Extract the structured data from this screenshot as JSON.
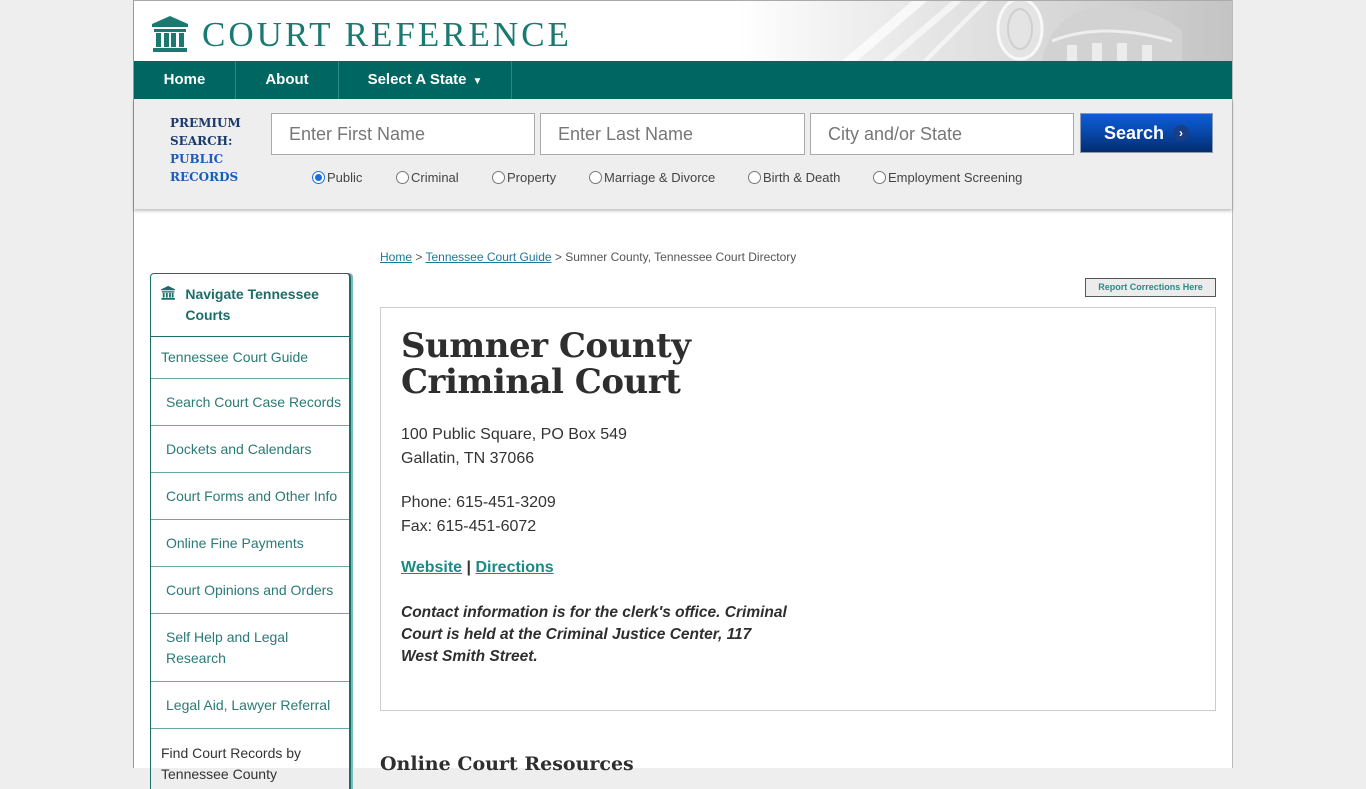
{
  "brand": {
    "name": "COURT REFERENCE",
    "color": "#1a7a72"
  },
  "nav": {
    "home": "Home",
    "about": "About",
    "select_state": "Select A State",
    "select_state_caret": "▼",
    "bg_color": "#006661"
  },
  "search": {
    "label_line1": "PREMIUM",
    "label_line2": "SEARCH:",
    "label_line3": "PUBLIC",
    "label_line4": "RECORDS",
    "first_name_placeholder": "Enter First Name",
    "last_name_placeholder": "Enter Last Name",
    "city_state_placeholder": "City and/or State",
    "button_label": "Search",
    "button_chevron": "›",
    "record_types": [
      {
        "label": "Public",
        "checked": true
      },
      {
        "label": "Criminal",
        "checked": false
      },
      {
        "label": "Property",
        "checked": false
      },
      {
        "label": "Marriage & Divorce",
        "checked": false
      },
      {
        "label": "Birth & Death",
        "checked": false
      },
      {
        "label": "Employment Screening",
        "checked": false
      }
    ]
  },
  "sidebar": {
    "title": "Navigate Tennessee Courts",
    "items": [
      {
        "label": "Tennessee Court Guide"
      },
      {
        "label": "Search Court Case Records"
      },
      {
        "label": "Dockets and Calendars"
      },
      {
        "label": "Court Forms and Other Info"
      },
      {
        "label": "Online Fine Payments"
      },
      {
        "label": "Court Opinions and Orders"
      },
      {
        "label": "Self Help and Legal Research"
      },
      {
        "label": "Legal Aid, Lawyer Referral"
      },
      {
        "label": "Find Court Records by Tennessee County"
      }
    ]
  },
  "breadcrumb": {
    "home": "Home",
    "sep": " > ",
    "guide": "Tennessee Court Guide",
    "current": "Sumner County, Tennessee Court Directory"
  },
  "report_corrections": "Report Corrections Here",
  "court": {
    "title_line1": "Sumner County",
    "title_line2": "Criminal Court",
    "address_line1": "100 Public Square, PO Box 549",
    "address_line2": "Gallatin, TN 37066",
    "phone": "Phone: 615-451-3209",
    "fax": "Fax: 615-451-6072",
    "website_label": "Website",
    "link_sep": " | ",
    "directions_label": "Directions",
    "note": "Contact information is for the clerk's office. Criminal Court is held at the Criminal Justice Center, 117 West Smith Street."
  },
  "resources_heading": "Online Court Resources"
}
